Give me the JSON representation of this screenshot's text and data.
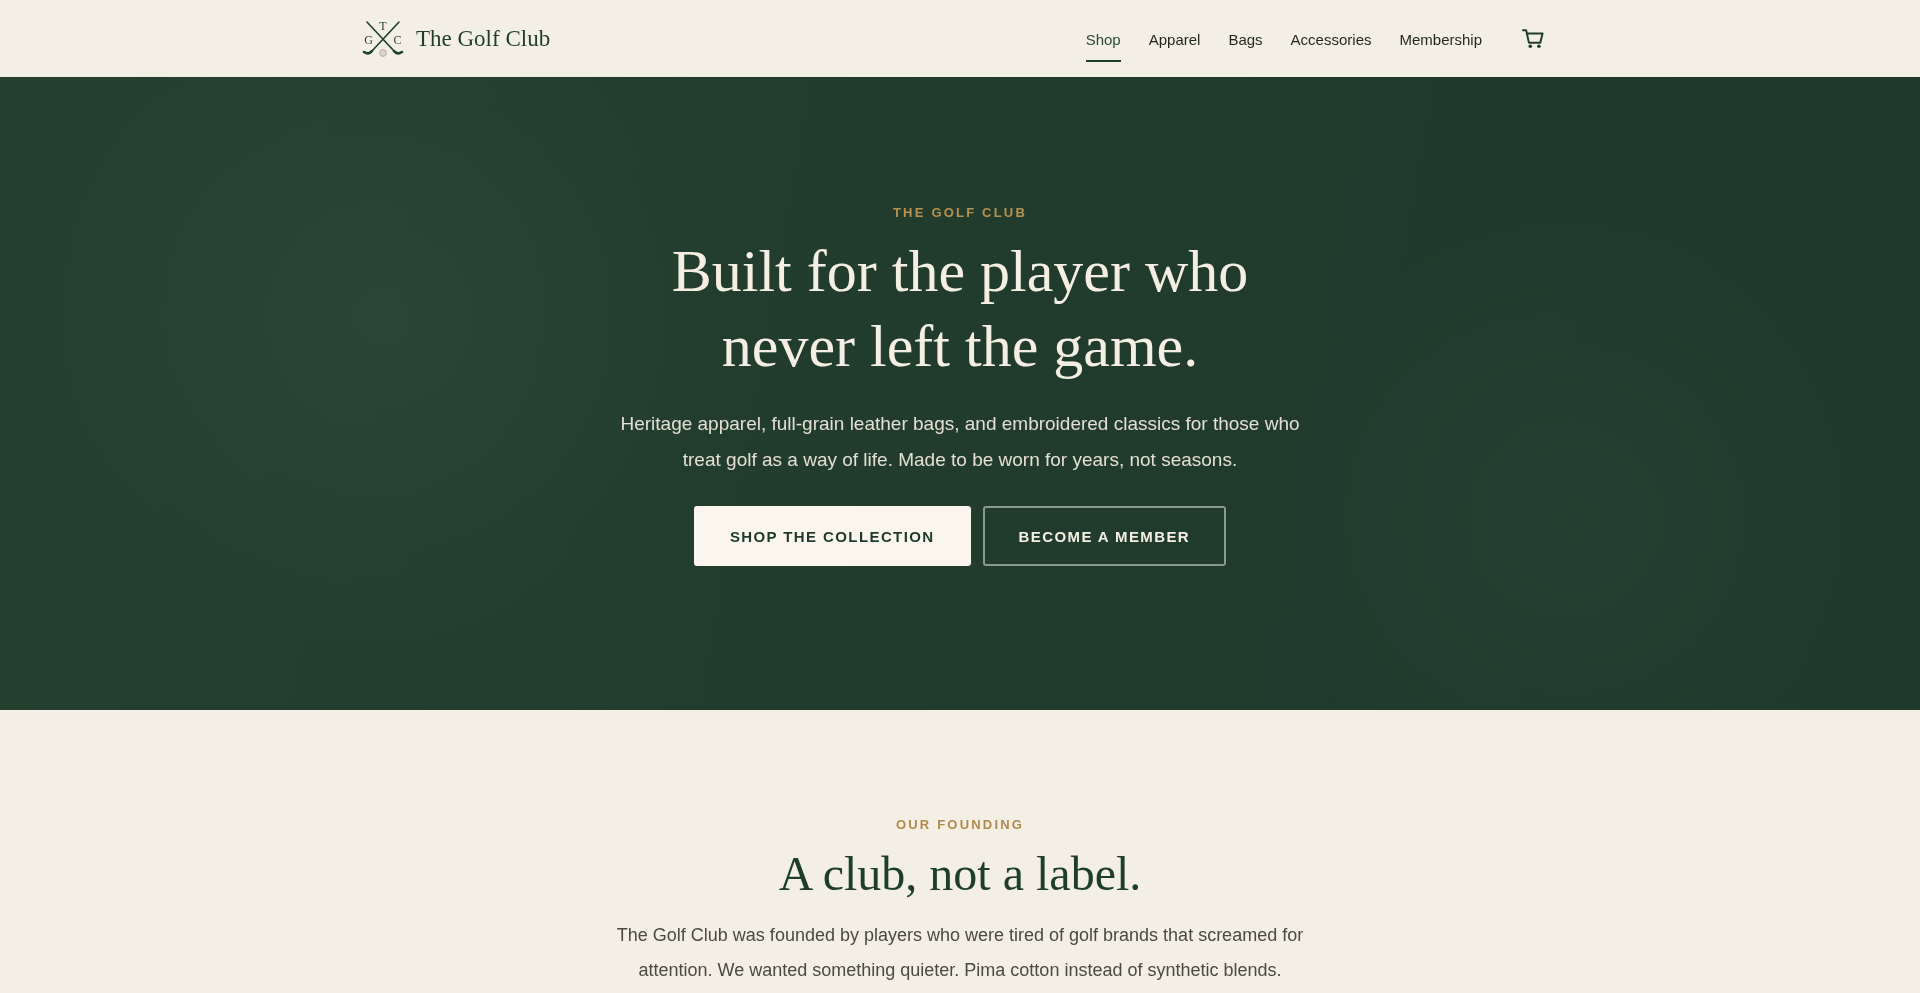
{
  "header": {
    "logo": {
      "monogram": [
        "T",
        "G",
        "C"
      ],
      "name": "The Golf Club"
    },
    "nav": [
      {
        "label": "Shop",
        "selected": true
      },
      {
        "label": "Apparel",
        "selected": false
      },
      {
        "label": "Bags",
        "selected": false
      },
      {
        "label": "Accessories",
        "selected": false
      },
      {
        "label": "Membership",
        "selected": false
      }
    ]
  },
  "hero": {
    "eyebrow": "THE GOLF CLUB",
    "headline": "Built for the player who never left the game.",
    "subtitle": "Heritage apparel, full-grain leather bags, and embroidered classics for those who treat golf as a way of life. Made to be worn for years, not seasons.",
    "buttons": [
      {
        "label": "SHOP THE COLLECTION",
        "kind": "primary"
      },
      {
        "label": "BECOME A MEMBER",
        "kind": "outline"
      }
    ]
  },
  "founding": {
    "eyebrow": "OUR FOUNDING",
    "headline": "A club, not a label.",
    "body": "The Golf Club was founded by players who were tired of golf brands that screamed for attention. We wanted something quieter. Pima cotton instead of synthetic blends."
  }
}
